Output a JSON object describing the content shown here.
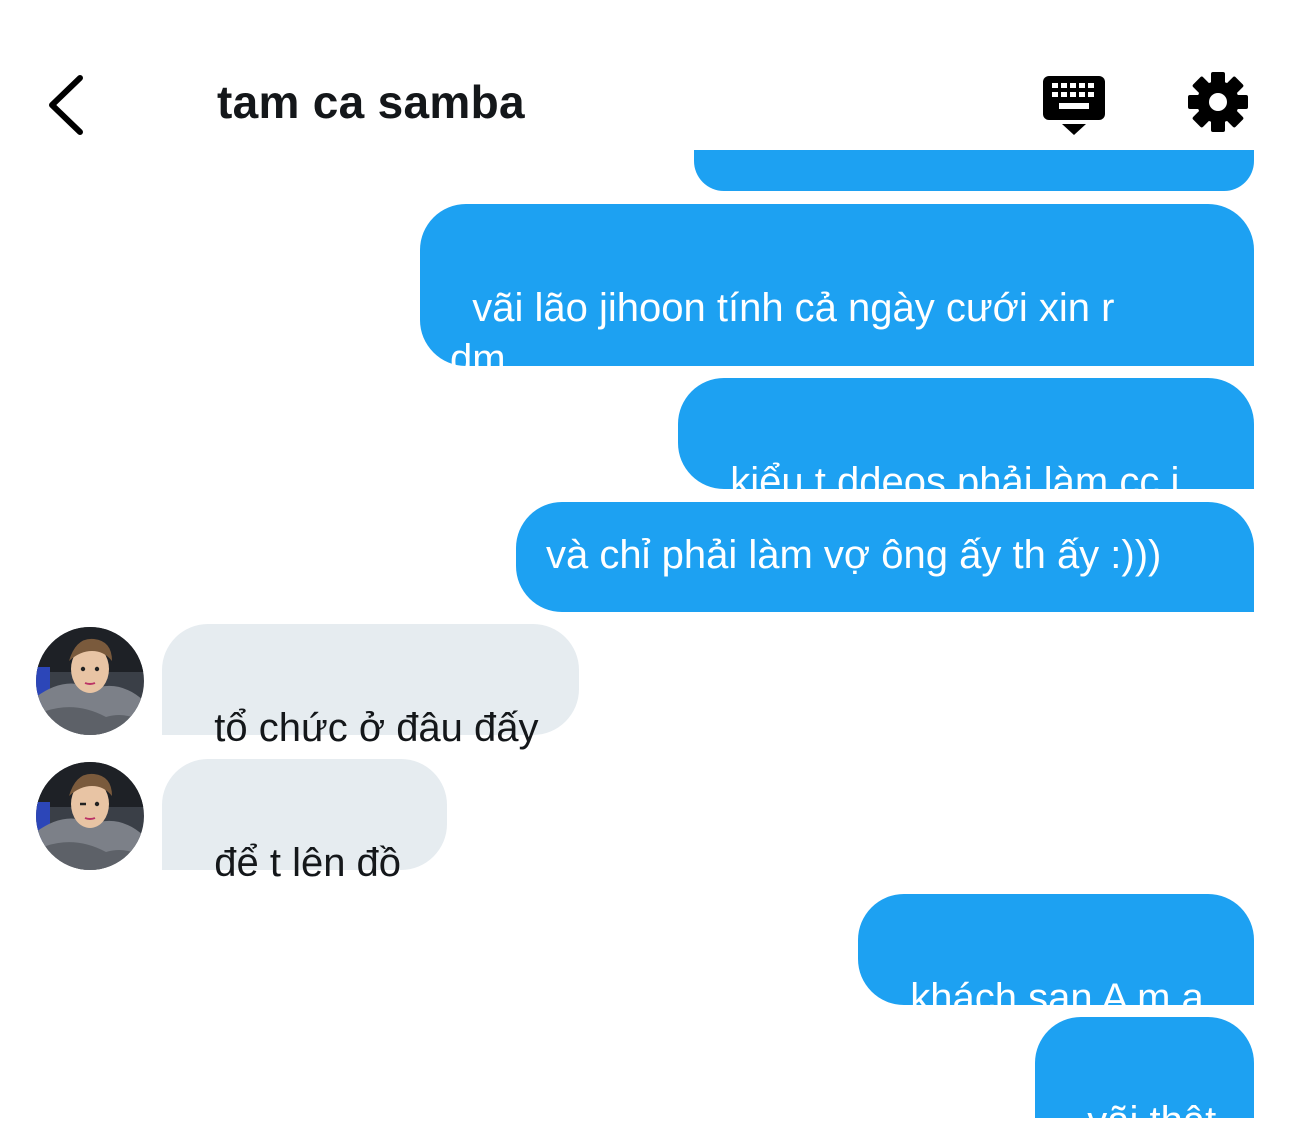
{
  "header": {
    "title": "tam ca samba",
    "back_icon": "chevron-left-icon",
    "keyboard_icon": "keyboard-icon",
    "settings_icon": "gear-icon"
  },
  "colors": {
    "outgoing_bubble": "#1da1f2",
    "incoming_bubble": "#e6ecf0",
    "text_dark": "#14171a"
  },
  "messages": [
    {
      "from": "me",
      "text": "vãi lão jihoon tính cả ngày cưới xin r dm"
    },
    {
      "from": "me",
      "text": "kiểu t ddeos phải làm cc j"
    },
    {
      "from": "me",
      "text": "và chỉ phải làm vợ ông ấy th ấy :)))"
    },
    {
      "from": "other",
      "text": "tổ chức ở đâu đấy"
    },
    {
      "from": "other",
      "text": "để t lên đồ"
    },
    {
      "from": "me",
      "text": "khách sạn A m ạ"
    },
    {
      "from": "me",
      "text": "vãi thật"
    }
  ]
}
